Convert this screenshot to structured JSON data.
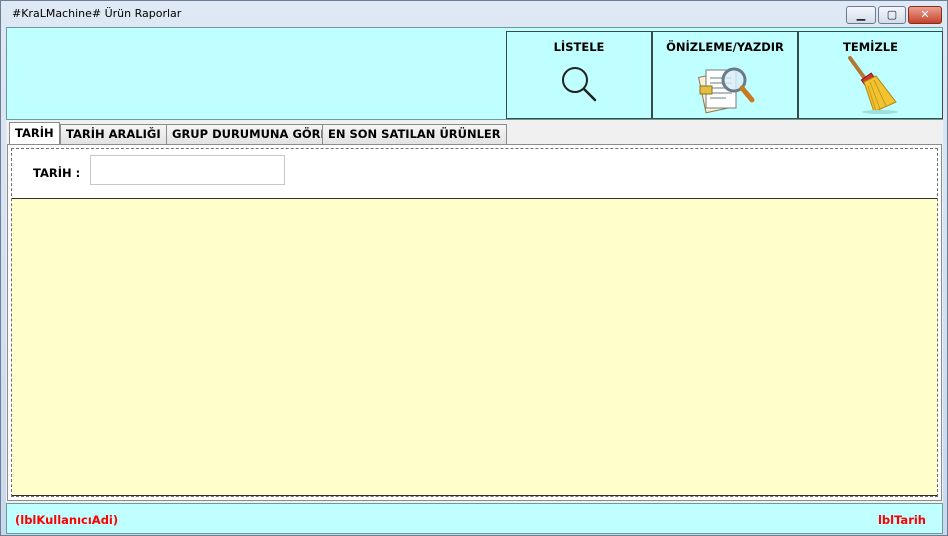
{
  "window": {
    "title": "#KraLMachine# Ürün Raporlar",
    "controls": {
      "minimize": "▁",
      "maximize": "▢",
      "close": "✕"
    }
  },
  "toolbar": {
    "listele_label": "LİSTELE",
    "onizleme_label": "ÖNİZLEME/YAZDIR",
    "temizle_label": "TEMİZLE",
    "icons": [
      "search-icon",
      "print-preview-icon",
      "broom-icon"
    ]
  },
  "tabs": [
    {
      "label": "TARİH",
      "active": true
    },
    {
      "label": "TARİH ARALIĞI",
      "active": false
    },
    {
      "label": "GRUP DURUMUNA GÖRE",
      "active": false
    },
    {
      "label": "EN SON SATILAN ÜRÜNLER",
      "active": false
    }
  ],
  "filter": {
    "tarih_label": "TARİH :",
    "tarih_value": ""
  },
  "status": {
    "left": "(lblKullanıcıAdi)",
    "right": "lblTarih"
  },
  "colors": {
    "panel": "#c0ffff",
    "grid": "#ffffcc",
    "status_text": "#ff0000"
  }
}
